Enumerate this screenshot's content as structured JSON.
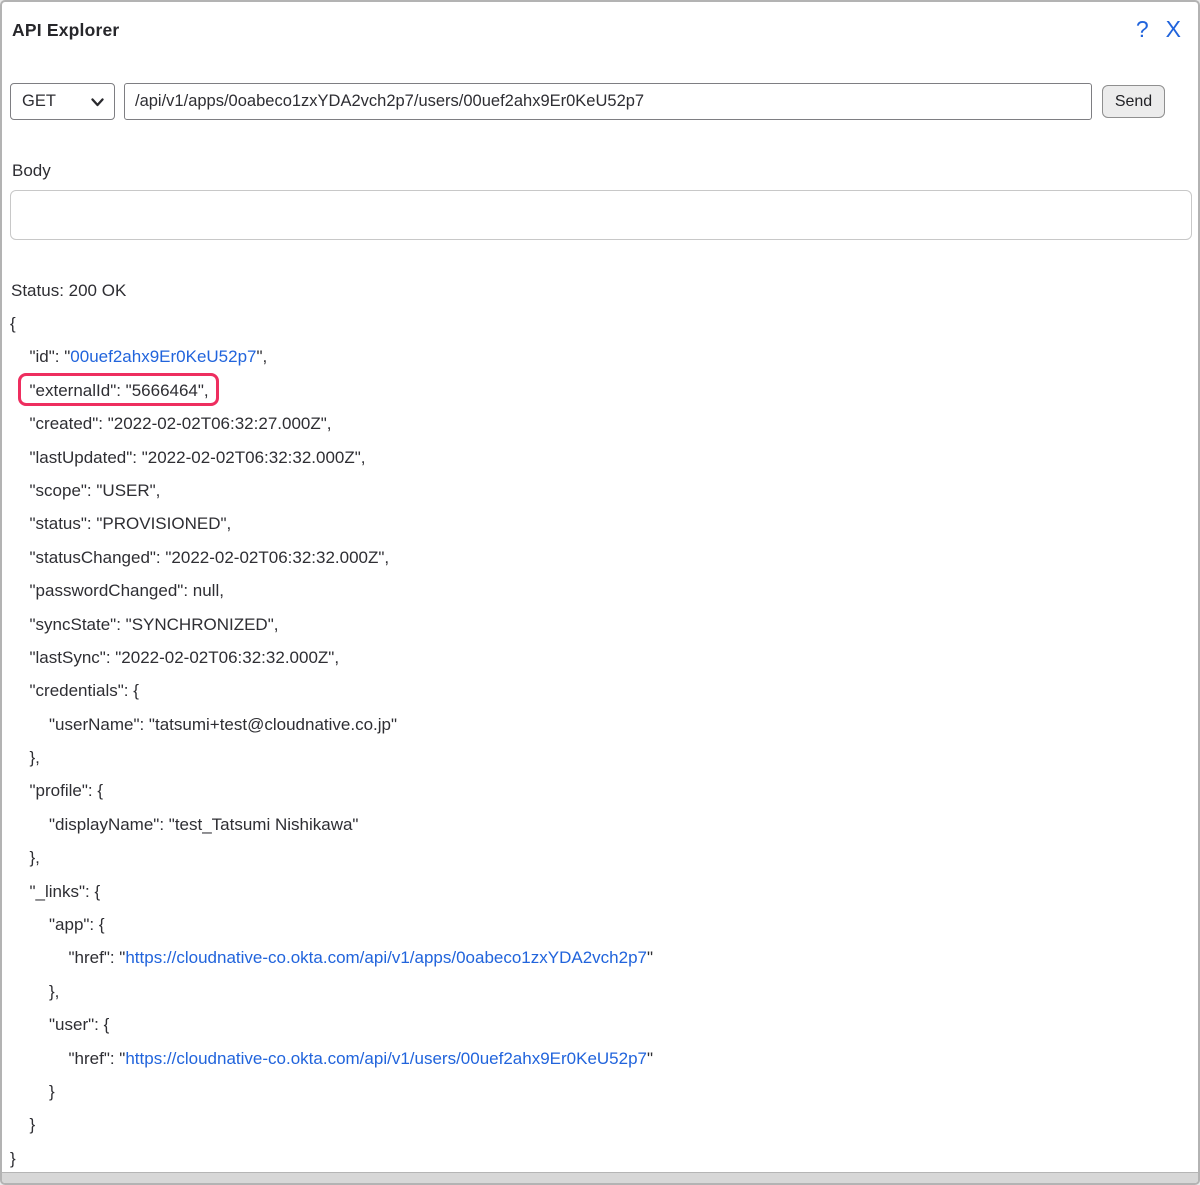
{
  "window": {
    "title": "API Explorer",
    "help_icon": "?",
    "close_icon": "X"
  },
  "request": {
    "method": "GET",
    "url": "/api/v1/apps/0oabeco1zxYDA2vch2p7/users/00uef2ahx9Er0KeU52p7",
    "send_label": "Send",
    "body_label": "Body",
    "body_value": ""
  },
  "response": {
    "status_label": "Status: 200 OK",
    "lines": [
      {
        "indent": 0,
        "segments": [
          {
            "text": "{"
          }
        ]
      },
      {
        "indent": 1,
        "segments": [
          {
            "text": "\"id\": \""
          },
          {
            "text": "00uef2ahx9Er0KeU52p7",
            "link": true
          },
          {
            "text": "\","
          }
        ]
      },
      {
        "indent": 1,
        "highlight": true,
        "segments": [
          {
            "text": "\"externalId\": \"5666464\","
          }
        ]
      },
      {
        "indent": 1,
        "segments": [
          {
            "text": "\"created\": \"2022-02-02T06:32:27.000Z\","
          }
        ]
      },
      {
        "indent": 1,
        "segments": [
          {
            "text": "\"lastUpdated\": \"2022-02-02T06:32:32.000Z\","
          }
        ]
      },
      {
        "indent": 1,
        "segments": [
          {
            "text": "\"scope\": \"USER\","
          }
        ]
      },
      {
        "indent": 1,
        "segments": [
          {
            "text": "\"status\": \"PROVISIONED\","
          }
        ]
      },
      {
        "indent": 1,
        "segments": [
          {
            "text": "\"statusChanged\": \"2022-02-02T06:32:32.000Z\","
          }
        ]
      },
      {
        "indent": 1,
        "segments": [
          {
            "text": "\"passwordChanged\": null,"
          }
        ]
      },
      {
        "indent": 1,
        "segments": [
          {
            "text": "\"syncState\": \"SYNCHRONIZED\","
          }
        ]
      },
      {
        "indent": 1,
        "segments": [
          {
            "text": "\"lastSync\": \"2022-02-02T06:32:32.000Z\","
          }
        ]
      },
      {
        "indent": 1,
        "segments": [
          {
            "text": "\"credentials\": {"
          }
        ]
      },
      {
        "indent": 2,
        "segments": [
          {
            "text": "\"userName\": \"tatsumi+test@cloudnative.co.jp\""
          }
        ]
      },
      {
        "indent": 1,
        "segments": [
          {
            "text": "},"
          }
        ]
      },
      {
        "indent": 1,
        "segments": [
          {
            "text": "\"profile\": {"
          }
        ]
      },
      {
        "indent": 2,
        "segments": [
          {
            "text": "\"displayName\": \"test_Tatsumi Nishikawa\""
          }
        ]
      },
      {
        "indent": 1,
        "segments": [
          {
            "text": "},"
          }
        ]
      },
      {
        "indent": 1,
        "segments": [
          {
            "text": "\"_links\": {"
          }
        ]
      },
      {
        "indent": 2,
        "segments": [
          {
            "text": "\"app\": {"
          }
        ]
      },
      {
        "indent": 3,
        "segments": [
          {
            "text": "\"href\": \""
          },
          {
            "text": "https://cloudnative-co.okta.com/api/v1/apps/0oabeco1zxYDA2vch2p7",
            "link": true
          },
          {
            "text": "\""
          }
        ]
      },
      {
        "indent": 2,
        "segments": [
          {
            "text": "},"
          }
        ]
      },
      {
        "indent": 2,
        "segments": [
          {
            "text": "\"user\": {"
          }
        ]
      },
      {
        "indent": 3,
        "segments": [
          {
            "text": "\"href\": \""
          },
          {
            "text": "https://cloudnative-co.okta.com/api/v1/users/00uef2ahx9Er0KeU52p7",
            "link": true
          },
          {
            "text": "\""
          }
        ]
      },
      {
        "indent": 2,
        "segments": [
          {
            "text": "}"
          }
        ]
      },
      {
        "indent": 1,
        "segments": [
          {
            "text": "}"
          }
        ]
      },
      {
        "indent": 0,
        "segments": [
          {
            "text": "}"
          }
        ]
      }
    ]
  },
  "colors": {
    "link_blue": "#2164dc",
    "highlight_pink": "#ee2e5f",
    "text": "#2e2e33"
  }
}
